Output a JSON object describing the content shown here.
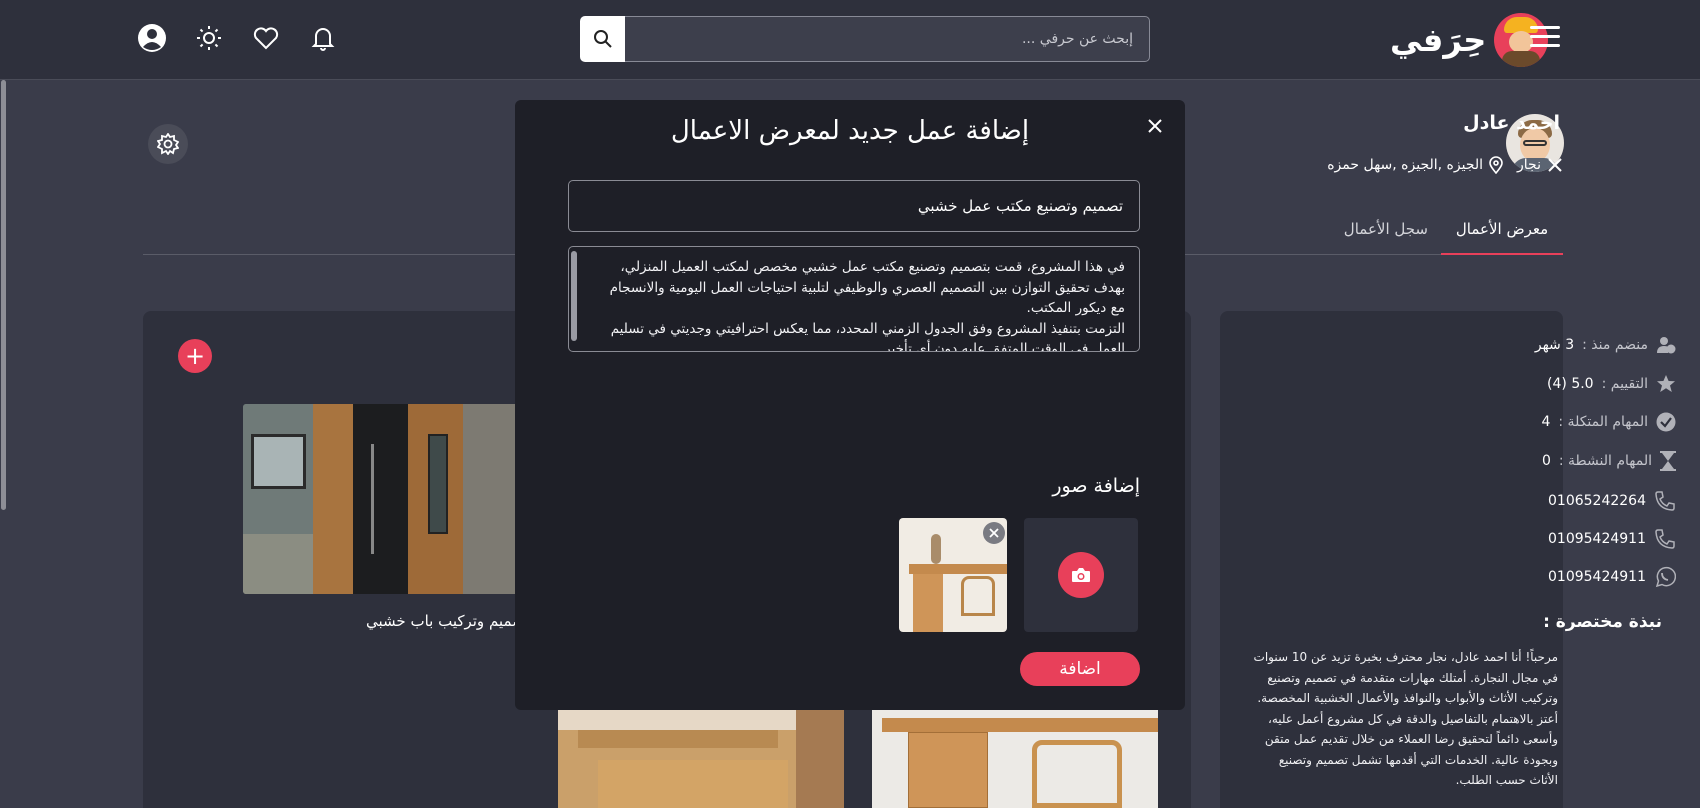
{
  "header": {
    "brand_name": "حِرَفي",
    "search_placeholder": "إبحث عن حرفي ...",
    "icons": [
      "user-icon",
      "sun-icon",
      "heart-icon",
      "bell-icon",
      "search-icon",
      "menu-icon"
    ]
  },
  "profile": {
    "name": "احمد عادل",
    "profession": "نجار",
    "location": "الجيزه ,الجيزه ,سهل حمزه",
    "tabs": [
      {
        "label": "معرض الأعمال",
        "active": true
      },
      {
        "label": "سجل الأعمال",
        "active": false
      }
    ]
  },
  "stats": [
    {
      "label": "منضم منذ :",
      "value": "3 شهر",
      "icon": "user-clock-icon"
    },
    {
      "label": "التقييم :",
      "value": "5.0 (4)",
      "icon": "star-icon"
    },
    {
      "label": "المهام المتكلة :",
      "value": "4",
      "icon": "check-circle-icon"
    },
    {
      "label": "المهام النشطة :",
      "value": "0",
      "icon": "hourglass-icon"
    }
  ],
  "contacts": [
    {
      "value": "01065242264",
      "icon": "phone-icon"
    },
    {
      "value": "01095424911",
      "icon": "phone-icon"
    },
    {
      "value": "01095424911",
      "icon": "whatsapp-icon"
    }
  ],
  "about": {
    "title": "نبذة مختصرة :",
    "text": "مرحباً! أنا احمد عادل، نجار محترف بخبرة تزيد عن 10 سنوات في مجال النجارة. أمتلك مهارات متقدمة في تصميم وتصنيع وتركيب الأثاث والأبواب والنوافذ والأعمال الخشبية المخصصة. أعتز بالاهتمام بالتفاصيل والدقة في كل مشروع أعمل عليه، وأسعى دائماً لتحقيق رضا العملاء من خلال تقديم عمل متقن وبجودة عالية. الخدمات التي أقدمها تشمل تصميم وتصنيع الأثاث حسب الطلب."
  },
  "portfolio": {
    "items": [
      {
        "caption": "تصميم وتركيب باب خشبي"
      }
    ]
  },
  "modal": {
    "title": "إضافة عمل جديد لمعرض الاعمال",
    "work_title_value": "تصميم وتصنيع مكتب عمل خشبي",
    "description": "في هذا المشروع، قمت بتصميم وتصنيع مكتب عمل خشبي مخصص لمكتب العميل المنزلي، بهدف تحقيق التوازن بين التصميم العصري والوظيفي لتلبية احتياجات العمل اليومية والانسجام مع ديكور المكتب.\nالتزمت بتنفيذ المشروع وفق الجدول الزمني المحدد، مما يعكس احترافيتي وجديتي في تسليم العمل في الوقت المتفق عليه دون أي تأخير.\nاعتمدت في تصنيع المكتب على استخدام مواد خشبية مستوردة ذات جودة عالية، لضمان المتانة والاستدامة، إضافة إلى مظهر جمالي يتناسب مع التصميم العصري المطلوب.",
    "add_images_label": "إضافة صور",
    "submit_label": "اضافة"
  },
  "colors": {
    "accent": "#e8405a",
    "background": "#3a3c4a",
    "card": "#2e303c",
    "modal": "#1e1f27"
  }
}
